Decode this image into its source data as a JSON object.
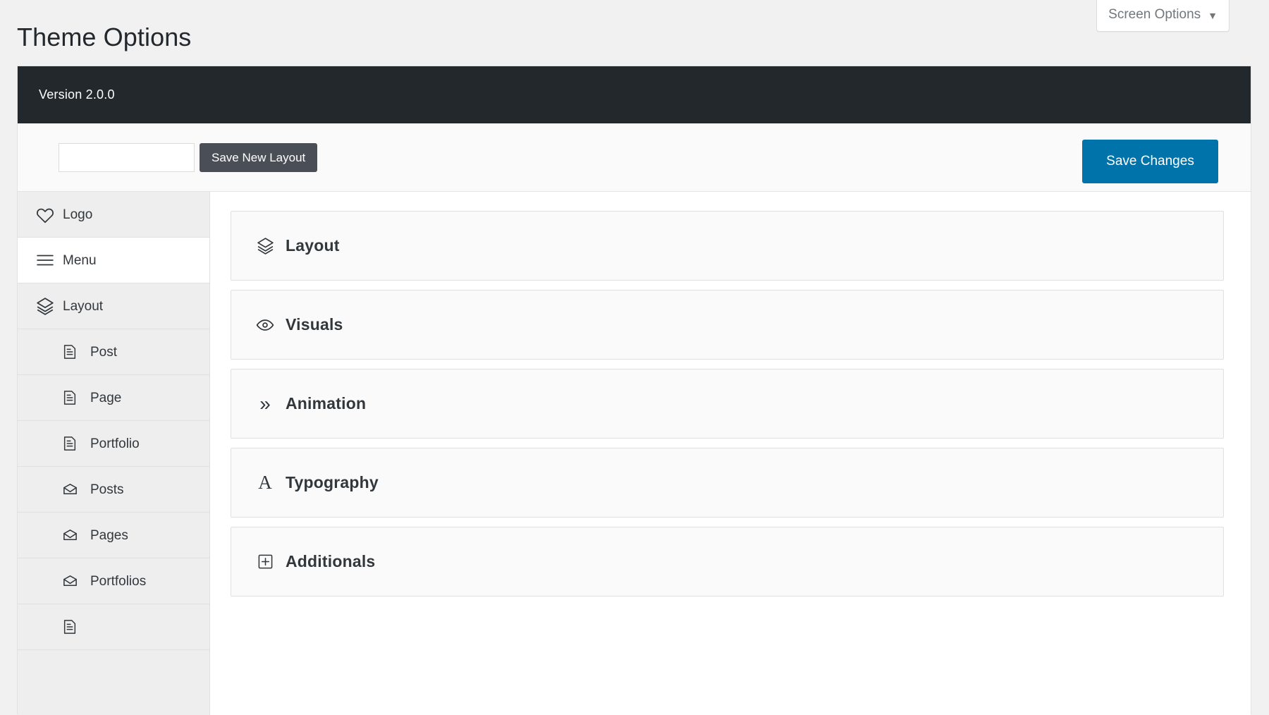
{
  "screen_options": {
    "label": "Screen Options",
    "caret": "▼",
    "icon": "chevron-down-icon"
  },
  "page_title": "Theme Options",
  "panel_header": {
    "version": "Version 2.0.0"
  },
  "toolbar": {
    "layout_name_value": "",
    "layout_name_placeholder": "",
    "save_new_layout_label": "Save New Layout",
    "save_changes_label": "Save Changes",
    "save_changes_color": "#0073aa",
    "save_new_layout_color": "#4a4f57"
  },
  "sidebar": {
    "items": [
      {
        "label": "Logo",
        "icon": "heart-icon",
        "level": "top",
        "active": false
      },
      {
        "label": "Menu",
        "icon": "hamburger-icon",
        "level": "top",
        "active": true
      },
      {
        "label": "Layout",
        "icon": "layers-icon",
        "level": "top",
        "active": false
      },
      {
        "label": "Post",
        "icon": "document-icon",
        "level": "sub",
        "active": false
      },
      {
        "label": "Page",
        "icon": "document-icon",
        "level": "sub",
        "active": false
      },
      {
        "label": "Portfolio",
        "icon": "document-icon",
        "level": "sub",
        "active": false
      },
      {
        "label": "Posts",
        "icon": "envelope-icon",
        "level": "sub",
        "active": false
      },
      {
        "label": "Pages",
        "icon": "envelope-icon",
        "level": "sub",
        "active": false
      },
      {
        "label": "Portfolios",
        "icon": "envelope-icon",
        "level": "sub",
        "active": false
      },
      {
        "label": "",
        "icon": "document-icon",
        "level": "sub",
        "active": false
      }
    ]
  },
  "panels": [
    {
      "label": "Layout",
      "icon": "layers-icon"
    },
    {
      "label": "Visuals",
      "icon": "eye-icon"
    },
    {
      "label": "Animation",
      "icon": "double-chevron-right-icon",
      "glyph": "»"
    },
    {
      "label": "Typography",
      "icon": "letter-a-icon",
      "glyph": "A"
    },
    {
      "label": "Additionals",
      "icon": "plus-square-icon"
    }
  ]
}
